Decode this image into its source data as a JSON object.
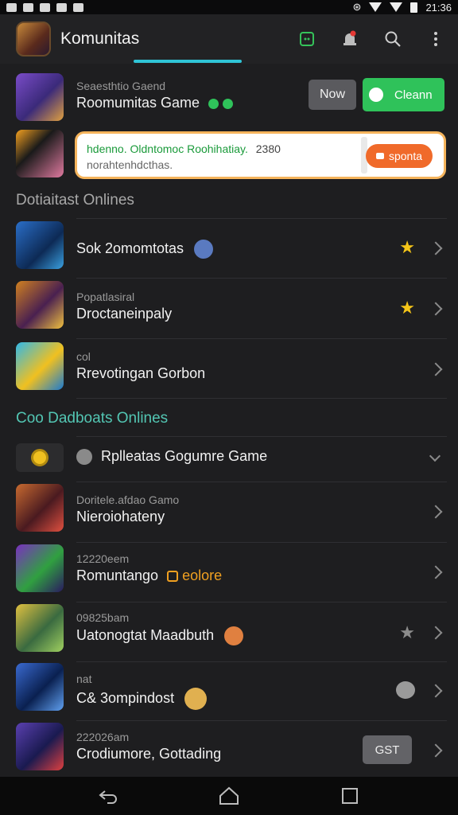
{
  "status_bar": {
    "time": "21:36"
  },
  "app_bar": {
    "title": "Komunitas",
    "icons": [
      "gamepad-icon",
      "bell-icon",
      "search-icon",
      "more-vert-icon"
    ]
  },
  "game_header": {
    "subtitle": "Seaesthtio Gaend",
    "title": "Roomumitas Game",
    "now_label": "Now",
    "cleanup_label": "Cleann"
  },
  "promo": {
    "line1": "hdenno. Oldntomoc Roohihatiay.",
    "number": "2380",
    "line2": "norahtenhdcthas.",
    "button_label": "sponta"
  },
  "section1": {
    "title": "Dotiaitast Onlines"
  },
  "list1": [
    {
      "sub": "",
      "title": "Sok 2omomtotas",
      "star": true,
      "star_color": "#f5c518"
    },
    {
      "sub": "Popatlasiral",
      "title": "Droctaneinpaly",
      "star": true,
      "star_color": "#f5c518"
    },
    {
      "sub": "col",
      "title": "Rrevotingan Gorbon",
      "star": false
    }
  ],
  "section2": {
    "title": "Coo Dadboats Onlines"
  },
  "expander": {
    "title": "Rplleatas Gogumre Game"
  },
  "list2": [
    {
      "sub": "Doritele.afdao Gamo",
      "title": "Nieroiohateny",
      "tag": "",
      "action": ""
    },
    {
      "sub": "12220eem",
      "title": "Romuntango",
      "tag": "eolore",
      "action": ""
    },
    {
      "sub": "09825bam",
      "title": "Uatonogtat Maadbuth",
      "tag": "",
      "action": "star"
    },
    {
      "sub": "nat",
      "title": "C& 3ompindost",
      "tag": "",
      "action": "face"
    },
    {
      "sub": "222026am",
      "title": "Crodiumore, Gottading",
      "tag": "",
      "action": "button",
      "button_label": "GST"
    }
  ],
  "colors": {
    "accent_teal": "#2fc4d6",
    "green": "#2fc25a",
    "orange": "#f06a2a",
    "star_yellow": "#f5c518"
  }
}
